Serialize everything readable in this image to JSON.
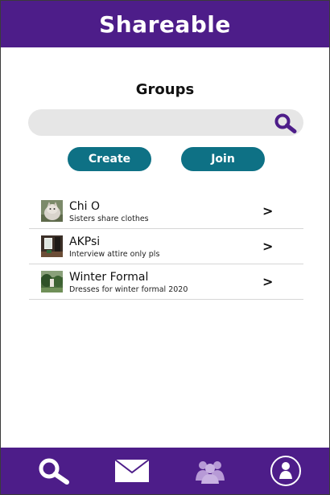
{
  "header": {
    "title": "Shareable"
  },
  "page": {
    "title": "Groups"
  },
  "search": {
    "placeholder": ""
  },
  "buttons": {
    "create_label": "Create",
    "join_label": "Join"
  },
  "groups": [
    {
      "name": "Chi O",
      "description": "Sisters share clothes",
      "chevron": ">",
      "thumb": "cat-photo"
    },
    {
      "name": "AKPsi",
      "description": "Interview attire only pls",
      "chevron": ">",
      "thumb": "interior-photo"
    },
    {
      "name": "Winter Formal",
      "description": "Dresses for winter formal 2020",
      "chevron": ">",
      "thumb": "garden-photo"
    }
  ],
  "nav": [
    {
      "icon": "search-icon"
    },
    {
      "icon": "mail-icon"
    },
    {
      "icon": "groups-icon",
      "active": true
    },
    {
      "icon": "profile-icon"
    }
  ],
  "colors": {
    "brand": "#4d1d89",
    "button": "#0e7185",
    "search_bg": "#e6e6e6",
    "active_nav_icon": "#b79ad6"
  }
}
